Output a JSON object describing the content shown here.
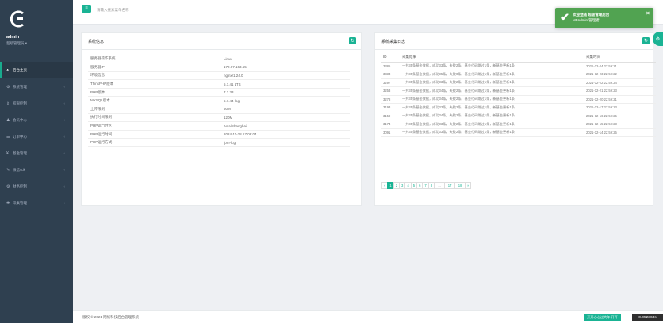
{
  "sidebar": {
    "user_name": "admin",
    "user_role": "超级管理员 ▾",
    "items": [
      {
        "label": "后台主页",
        "icon": "home-icon",
        "glyph": "♣",
        "active": true,
        "chev": ""
      },
      {
        "label": "系统管理",
        "icon": "settings-icon",
        "glyph": "⚙",
        "active": false,
        "chev": "‹"
      },
      {
        "label": "权限控制",
        "icon": "key-icon",
        "glyph": "⚷",
        "active": false,
        "chev": "‹"
      },
      {
        "label": "会员中心",
        "icon": "user-icon",
        "glyph": "♟",
        "active": false,
        "chev": "‹"
      },
      {
        "label": "订单中心",
        "icon": "list-icon",
        "glyph": "☰",
        "active": false,
        "chev": "‹"
      },
      {
        "label": "基金管理",
        "icon": "yen-icon",
        "glyph": "¥",
        "active": false,
        "chev": "‹"
      },
      {
        "label": "微信sdk",
        "icon": "wrench-icon",
        "glyph": "✎",
        "active": false,
        "chev": "‹"
      },
      {
        "label": "财务控制",
        "icon": "gear-icon",
        "glyph": "⚙",
        "active": false,
        "chev": "‹"
      },
      {
        "label": "采集管理",
        "icon": "cogs-icon",
        "glyph": "✱",
        "active": false,
        "chev": "‹"
      }
    ]
  },
  "topbar": {
    "search_placeholder": "请输入搜索菜单名称"
  },
  "toast": {
    "line1": "欢迎登陆 超级管理后台",
    "line2": "MFAdmin 管理者",
    "close": "×"
  },
  "system_panel": {
    "title": "系统信息",
    "rows": [
      {
        "k": "服务器操作系统",
        "v": "Linux"
      },
      {
        "k": "服务器IP",
        "v": "172.67.163.55"
      },
      {
        "k": "环境信息",
        "v": "nginx/1.24.0"
      },
      {
        "k": "ThinkPHP版本",
        "v": "5.1.41 LTS"
      },
      {
        "k": "PHP版本",
        "v": "7.2.33"
      },
      {
        "k": "MYSQL版本",
        "v": "5.7.44-log"
      },
      {
        "k": "上传限制",
        "v": "50M"
      },
      {
        "k": "执行时间限制",
        "v": "120M"
      },
      {
        "k": "PHP运行时区",
        "v": "Asia/Shanghai"
      },
      {
        "k": "PHP运行时间",
        "v": "2024-11-28 17:08:04"
      },
      {
        "k": "PHP运行方式",
        "v": "fpm-fcgi"
      }
    ]
  },
  "log_panel": {
    "title": "系统采集日志",
    "headers": {
      "id": "ID",
      "result": "采集结果",
      "time": "采集时间"
    },
    "rows": [
      {
        "id": "3385",
        "result": "一共35条基金数据，成功33条，失败2条。基金代码跳过1条，新基金更新1条",
        "time": "2021-12-24 22:59:21"
      },
      {
        "id": "3333",
        "result": "一共35条基金数据，成功35条，失败0条。基金代码跳过1条，新基金更新1条",
        "time": "2021-12-23 22:59:22"
      },
      {
        "id": "3297",
        "result": "一共35条基金数据，成功33条，失败2条。基金代码跳过1条，新基金更新1条",
        "time": "2021-12-22 22:59:24"
      },
      {
        "id": "3253",
        "result": "一共35条基金数据，成功34条，失败2条。基金代码跳过1条，新基金更新1条",
        "time": "2021-12-21 22:59:23"
      },
      {
        "id": "3278",
        "result": "一共35条基金数据，成功34条，失败2条。基金代码跳过1条，新基金更新1条",
        "time": "2021-12-20 22:59:21"
      },
      {
        "id": "3193",
        "result": "一共35条基金数据，成功33条，失败2条。基金代码跳过1条，新基金更新1条",
        "time": "2021-12-17 22:59:23"
      },
      {
        "id": "3159",
        "result": "一共35条基金数据，成功34条，失败2条。基金代码跳过1条，新基金更新1条",
        "time": "2021-12-16 22:59:25"
      },
      {
        "id": "3174",
        "result": "一共35条基金数据，成功33条，失败2条。基金代码跳过1条，新基金更新1条",
        "time": "2021-12-15 22:59:23"
      },
      {
        "id": "3091",
        "result": "一共35条基金数据，成功33条，失败2条。基金代码跳过1条，新基金更新1条",
        "time": "2021-12-14 22:59:25"
      }
    ],
    "pager": [
      "«",
      "1",
      "2",
      "3",
      "4",
      "5",
      "6",
      "7",
      "8",
      "...",
      "17",
      "18",
      "»"
    ],
    "pager_active": "1"
  },
  "footer": {
    "copyright": "版权 © 2021 网络科技后台管理系统",
    "badge": "开开心心过大年 开开",
    "timer": "0.052363s"
  },
  "colors": {
    "accent": "#1ab394",
    "sidebar": "#2f4050",
    "toast": "#51a351"
  }
}
